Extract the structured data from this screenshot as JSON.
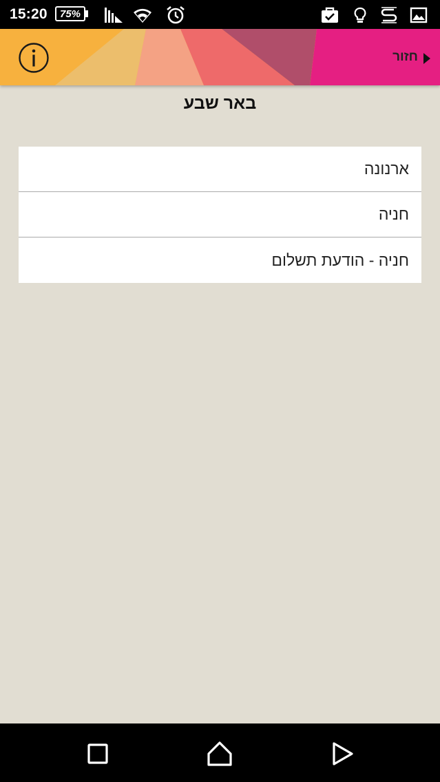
{
  "status_bar": {
    "time": "15:20",
    "battery": "75%",
    "icons": [
      "signal-icon",
      "wifi-icon",
      "alarm-icon",
      "briefcase-check-icon",
      "lightbulb-icon",
      "s-app-icon",
      "image-icon"
    ]
  },
  "header": {
    "back_label": "חזור",
    "info_icon": "info-icon",
    "colors": [
      "#f7b13e",
      "#ecbe6c",
      "#f4a284",
      "#ee6a6a",
      "#b04e6a",
      "#e51f82"
    ]
  },
  "page": {
    "title": "באר שבע"
  },
  "menu": {
    "items": [
      {
        "label": "ארנונה"
      },
      {
        "label": "חניה"
      },
      {
        "label": "חניה - הודעת תשלום"
      }
    ]
  },
  "nav_bar": {
    "recent": "recent-apps-icon",
    "home": "home-icon",
    "back": "back-icon"
  }
}
